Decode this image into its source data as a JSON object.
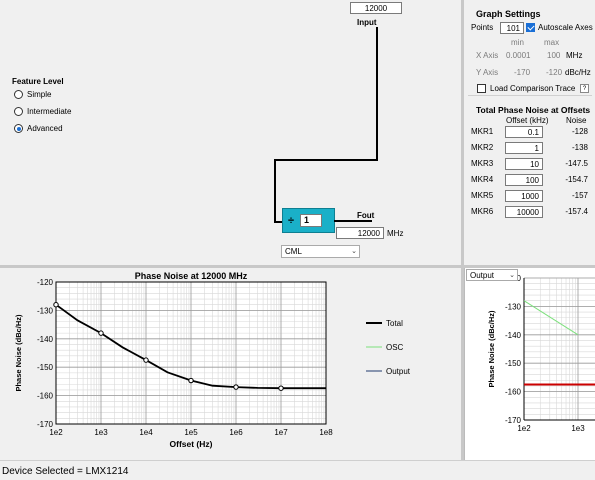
{
  "diagram": {
    "input_freq": "12000",
    "input_label": "Input",
    "divider_symbol": "÷",
    "divider_value": "1",
    "fout_label": "Fout",
    "fout_value": "12000",
    "fout_unit": "MHz",
    "output_format": "CML"
  },
  "feature_level": {
    "title": "Feature Level",
    "options": [
      {
        "label": "Simple",
        "selected": false
      },
      {
        "label": "Intermediate",
        "selected": false
      },
      {
        "label": "Advanced",
        "selected": true
      }
    ]
  },
  "graph_settings": {
    "title": "Graph Settings",
    "points_label": "Points",
    "points_value": "101",
    "autoscale_label": "Autoscale Axes",
    "autoscale_checked": true,
    "min_header": "min",
    "max_header": "max",
    "x_axis_label": "X Axis",
    "x_min": "0.0001",
    "x_max": "100",
    "x_unit": "MHz",
    "y_axis_label": "Y Axis",
    "y_min": "-170",
    "y_max": "-120",
    "y_unit": "dBc/Hz",
    "load_comparison_label": "Load Comparison Trace",
    "help_glyph": "?"
  },
  "offsets": {
    "title": "Total Phase Noise at Offsets",
    "col_offset": "Offset (kHz)",
    "col_noise": "Noise",
    "rows": [
      {
        "name": "MKR1",
        "offset": "0.1",
        "noise": "-128"
      },
      {
        "name": "MKR2",
        "offset": "1",
        "noise": "-138"
      },
      {
        "name": "MKR3",
        "offset": "10",
        "noise": "-147.5"
      },
      {
        "name": "MKR4",
        "offset": "100",
        "noise": "-154.7"
      },
      {
        "name": "MKR5",
        "offset": "1000",
        "noise": "-157"
      },
      {
        "name": "MKR6",
        "offset": "10000",
        "noise": "-157.4"
      }
    ]
  },
  "right_chart": {
    "dropdown_value": "Output"
  },
  "status": {
    "text": "Device Selected = LMX1214"
  },
  "colors": {
    "divider_block": "#1ab0c8",
    "total": "#000000",
    "osc": "#7de07d",
    "output": "#1f3a6e",
    "marker_line": "#cc0000"
  },
  "chart_data": [
    {
      "type": "line",
      "title": "Phase Noise at 12000 MHz",
      "xlabel": "Offset (Hz)",
      "ylabel": "Phase Noise (dBc/Hz)",
      "x_scale": "log",
      "xlim": [
        100,
        100000000
      ],
      "ylim": [
        -170,
        -120
      ],
      "x_ticks": [
        "1e2",
        "1e3",
        "1e4",
        "1e5",
        "1e6",
        "1e7",
        "1e8"
      ],
      "y_ticks": [
        "-120",
        "-130",
        "-140",
        "-150",
        "-160",
        "-170"
      ],
      "grid": true,
      "legend": "right",
      "series": [
        {
          "name": "Total",
          "x": [
            100,
            300,
            1000,
            3000,
            10000,
            30000,
            100000,
            300000,
            1000000,
            3000000,
            10000000,
            100000000
          ],
          "y": [
            -128,
            -133.5,
            -138,
            -143,
            -147.5,
            -151.8,
            -154.7,
            -156.5,
            -157,
            -157.3,
            -157.4,
            -157.4
          ]
        },
        {
          "name": "OSC",
          "x": [],
          "y": []
        },
        {
          "name": "Output",
          "x": [],
          "y": []
        }
      ],
      "markers": {
        "x": [
          100,
          1000,
          10000,
          100000,
          1000000,
          10000000
        ],
        "y": [
          -128,
          -138,
          -147.5,
          -154.7,
          -157,
          -157.4
        ]
      }
    },
    {
      "type": "line",
      "xlabel": "",
      "ylabel": "Phase Noise (dBc/Hz)",
      "x_scale": "log",
      "xlim": [
        100,
        1000
      ],
      "ylim": [
        -170,
        -120
      ],
      "x_ticks": [
        "1e2",
        "1e3"
      ],
      "y_ticks": [
        "-120",
        "-130",
        "-140",
        "-150",
        "-160",
        "-170"
      ],
      "grid": true,
      "series": [
        {
          "name": "OSC",
          "x": [
            100,
            1000
          ],
          "y": [
            -128,
            -140
          ]
        },
        {
          "name": "Output",
          "x": [
            100,
            1000
          ],
          "y": [
            -157.5,
            -157.5
          ]
        }
      ]
    }
  ]
}
